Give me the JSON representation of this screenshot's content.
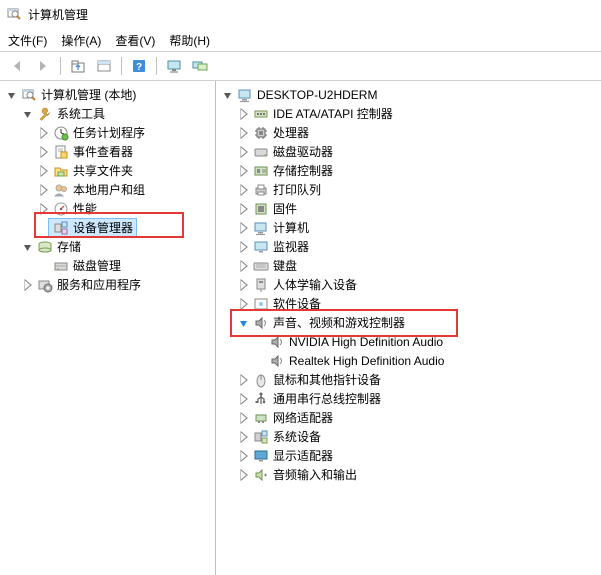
{
  "window": {
    "title": "计算机管理"
  },
  "menu": {
    "file": "文件(F)",
    "action": "操作(A)",
    "view": "查看(V)",
    "help": "帮助(H)"
  },
  "left_tree": {
    "root": "计算机管理 (本地)",
    "system_tools": "系统工具",
    "task_scheduler": "任务计划程序",
    "event_viewer": "事件查看器",
    "shared_folders": "共享文件夹",
    "local_users": "本地用户和组",
    "performance": "性能",
    "device_manager": "设备管理器",
    "storage": "存储",
    "disk_management": "磁盘管理",
    "services_apps": "服务和应用程序"
  },
  "right_tree": {
    "computer_name": "DESKTOP-U2HDERM",
    "ide": "IDE ATA/ATAPI 控制器",
    "processors": "处理器",
    "disk_drives": "磁盘驱动器",
    "storage_controllers": "存储控制器",
    "print_queues": "打印队列",
    "firmware": "固件",
    "computer": "计算机",
    "monitors": "监视器",
    "keyboards": "键盘",
    "hid": "人体学输入设备",
    "software_devices": "软件设备",
    "sound": "声音、视频和游戏控制器",
    "nvidia_audio": "NVIDIA High Definition Audio",
    "realtek_audio": "Realtek High Definition Audio",
    "mice": "鼠标和其他指针设备",
    "usb": "通用串行总线控制器",
    "network": "网络适配器",
    "system_devices": "系统设备",
    "display": "显示适配器",
    "audio_io": "音频输入和输出"
  }
}
